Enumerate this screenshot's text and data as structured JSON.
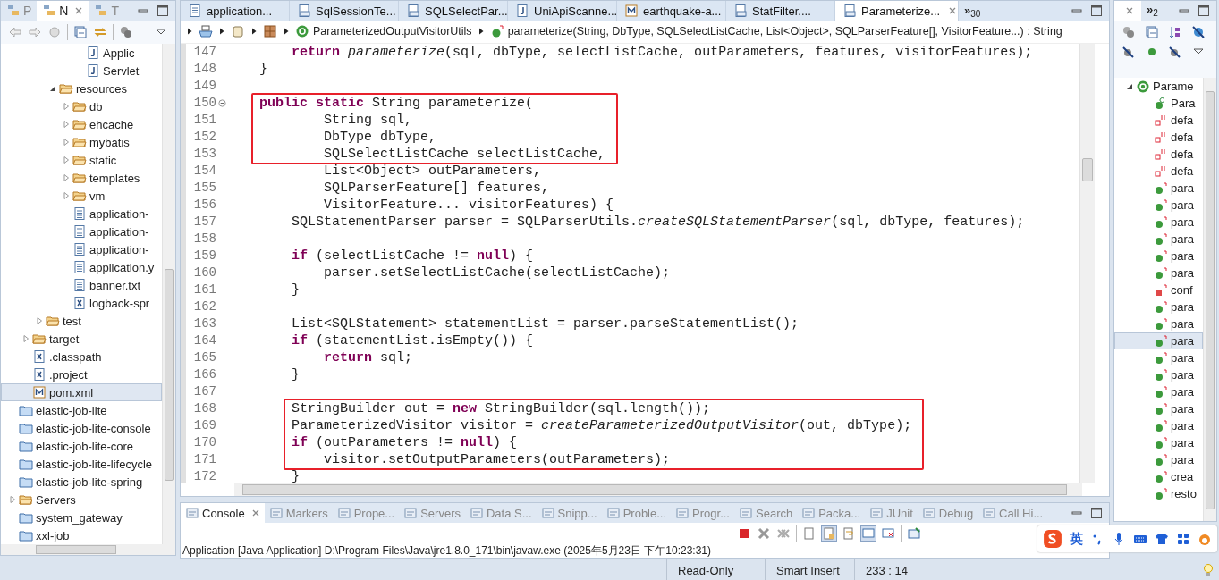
{
  "explorer": {
    "tabs": [
      {
        "label": "P",
        "selected": false
      },
      {
        "label": "N",
        "selected": true
      },
      {
        "label": "T",
        "selected": false
      }
    ],
    "tree": [
      {
        "children": [
          {
            "children": [
              {
                "children": [
                  {
                    "children": [
                      {
                        "children": [
                          {
                            "label": "Applic",
                            "kind": "java"
                          },
                          {
                            "label": "Servlet",
                            "kind": "java"
                          }
                        ]
                      }
                    ]
                  },
                  {
                    "label": "resources",
                    "kind": "folder",
                    "expanded": true,
                    "children": [
                      {
                        "label": "db",
                        "kind": "folder",
                        "expanded": false
                      },
                      {
                        "label": "ehcache",
                        "kind": "folder",
                        "expanded": false
                      },
                      {
                        "label": "mybatis",
                        "kind": "folder",
                        "expanded": false
                      },
                      {
                        "label": "static",
                        "kind": "folder",
                        "expanded": false
                      },
                      {
                        "label": "templates",
                        "kind": "folder",
                        "expanded": false
                      },
                      {
                        "label": "vm",
                        "kind": "folder",
                        "expanded": false
                      },
                      {
                        "label": "application-",
                        "kind": "file"
                      },
                      {
                        "label": "application-",
                        "kind": "file"
                      },
                      {
                        "label": "application-",
                        "kind": "file"
                      },
                      {
                        "label": "application.y",
                        "kind": "file"
                      },
                      {
                        "label": "banner.txt",
                        "kind": "file"
                      },
                      {
                        "label": "logback-spr",
                        "kind": "xml"
                      }
                    ]
                  }
                ]
              },
              {
                "label": "test",
                "kind": "folder",
                "expanded": false
              }
            ]
          },
          {
            "label": "target",
            "kind": "folder",
            "expanded": false
          },
          {
            "label": ".classpath",
            "kind": "xml"
          },
          {
            "label": ".project",
            "kind": "xml"
          },
          {
            "label": "pom.xml",
            "kind": "maven",
            "selected": true
          }
        ]
      },
      {
        "label": "elastic-job-lite",
        "kind": "project"
      },
      {
        "label": "elastic-job-lite-console",
        "kind": "project"
      },
      {
        "label": "elastic-job-lite-core",
        "kind": "project"
      },
      {
        "label": "elastic-job-lite-lifecycle",
        "kind": "project"
      },
      {
        "label": "elastic-job-lite-spring",
        "kind": "project"
      },
      {
        "label": "Servers",
        "kind": "folder",
        "expanded": false
      },
      {
        "label": "system_gateway",
        "kind": "project"
      },
      {
        "label": "xxl-job",
        "kind": "project"
      }
    ]
  },
  "editor": {
    "tabs": [
      {
        "label": "application...",
        "kind": "file",
        "selected": false
      },
      {
        "label": "SqlSessionTe...",
        "kind": "class",
        "selected": false
      },
      {
        "label": "SQLSelectPar...",
        "kind": "class",
        "selected": false
      },
      {
        "label": "UniApiScanne...",
        "kind": "java",
        "selected": false
      },
      {
        "label": "earthquake-a...",
        "kind": "maven",
        "selected": false
      },
      {
        "label": "StatFilter....",
        "kind": "class",
        "selected": false
      },
      {
        "label": "Parameterize...",
        "kind": "class",
        "selected": true
      }
    ],
    "more_tabs": {
      "glyph": "»",
      "count": "30"
    },
    "breadcrumb": [
      {
        "label": "ParameterizedOutputVisitorUtils",
        "kind": "class"
      },
      {
        "label": "parameterize(String, DbType, SQLSelectListCache, List<Object>, SQLParserFeature[], VisitorFeature...) : String",
        "kind": "method"
      }
    ],
    "blocks": [
      {
        "boxed": false,
        "lines": [
          {
            "num": "147",
            "text": "        **return** *parameterize*(sql, dbType, selectListCache, outParameters, features, visitorFeatures);"
          },
          {
            "num": "148",
            "text": "    }"
          },
          {
            "num": "149"
          }
        ]
      },
      {
        "boxed": true,
        "lines": [
          {
            "num": "150",
            "text": "    **public** **static** String parameterize(",
            "folded": false
          },
          {
            "num": "151",
            "text": "            String sql,"
          },
          {
            "num": "152",
            "text": "            DbType dbType,"
          },
          {
            "num": "153",
            "text": "            SQLSelectListCache selectListCache,"
          }
        ]
      },
      {
        "boxed": false,
        "lines": [
          {
            "num": "154",
            "text": "            List<Object> outParameters,"
          },
          {
            "num": "155",
            "text": "            SQLParserFeature[] features,"
          },
          {
            "num": "156",
            "text": "            VisitorFeature... visitorFeatures) {"
          },
          {
            "num": "157",
            "text": "        SQLStatementParser parser = SQLParserUtils.*createSQLStatementParser*(sql, dbType, features);"
          },
          {
            "num": "158"
          },
          {
            "num": "159",
            "text": "        **if** (selectListCache != **null**) {"
          },
          {
            "num": "160",
            "text": "            parser.setSelectListCache(selectListCache);"
          },
          {
            "num": "161",
            "text": "        }"
          },
          {
            "num": "162"
          },
          {
            "num": "163",
            "text": "        List<SQLStatement> statementList = parser.parseStatementList();"
          },
          {
            "num": "164",
            "text": "        **if** (statementList.isEmpty()) {"
          },
          {
            "num": "165",
            "text": "            **return** sql;"
          },
          {
            "num": "166",
            "text": "        }"
          },
          {
            "num": "167"
          }
        ]
      },
      {
        "boxed": true,
        "lines": [
          {
            "num": "168",
            "text": "        StringBuilder out = **new** StringBuilder(sql.length());"
          },
          {
            "num": "169",
            "text": "        ParameterizedVisitor visitor = *createParameterizedOutputVisitor*(out, dbType);"
          },
          {
            "num": "170",
            "text": "        **if** (outParameters != **null**) {"
          },
          {
            "num": "171",
            "text": "            visitor.setOutputParameters(outParameters);"
          }
        ]
      },
      {
        "boxed": false,
        "lines": [
          {
            "num": "172",
            "text": "        }"
          }
        ]
      }
    ]
  },
  "outline": {
    "more_tabs": {
      "glyph": "»",
      "count": "2"
    },
    "tree": [
      {
        "label": "Parame",
        "kind": "class",
        "expanded": true,
        "children": [
          {
            "label": "Para",
            "kind": "constructor",
            "selected": false
          },
          {
            "label": "defa",
            "kind": "field",
            "selected": false
          },
          {
            "label": "defa",
            "kind": "field",
            "selected": false
          },
          {
            "label": "defa",
            "kind": "field",
            "selected": false
          },
          {
            "label": "defa",
            "kind": "field",
            "selected": false
          },
          {
            "label": "para",
            "kind": "method",
            "selected": false
          },
          {
            "label": "para",
            "kind": "method",
            "selected": false
          },
          {
            "label": "para",
            "kind": "method",
            "selected": false
          },
          {
            "label": "para",
            "kind": "method",
            "selected": false
          },
          {
            "label": "para",
            "kind": "method",
            "selected": false
          },
          {
            "label": "para",
            "kind": "method",
            "selected": false
          },
          {
            "label": "conf",
            "kind": "private",
            "selected": false
          },
          {
            "label": "para",
            "kind": "method",
            "selected": false
          },
          {
            "label": "para",
            "kind": "method",
            "selected": false
          },
          {
            "label": "para",
            "kind": "method",
            "selected": true
          },
          {
            "label": "para",
            "kind": "method",
            "selected": false
          },
          {
            "label": "para",
            "kind": "method",
            "selected": false
          },
          {
            "label": "para",
            "kind": "method",
            "selected": false
          },
          {
            "label": "para",
            "kind": "method",
            "selected": false
          },
          {
            "label": "para",
            "kind": "method",
            "selected": false
          },
          {
            "label": "para",
            "kind": "method",
            "selected": false
          },
          {
            "label": "para",
            "kind": "method",
            "selected": false
          },
          {
            "label": "crea",
            "kind": "method",
            "selected": false
          },
          {
            "label": "resto",
            "kind": "method",
            "selected": false
          }
        ]
      }
    ]
  },
  "console": {
    "tabs": [
      {
        "label": "Console",
        "selected": true
      },
      {
        "label": "Markers",
        "selected": false
      },
      {
        "label": "Prope...",
        "selected": false
      },
      {
        "label": "Servers",
        "selected": false
      },
      {
        "label": "Data S...",
        "selected": false
      },
      {
        "label": "Snipp...",
        "selected": false
      },
      {
        "label": "Proble...",
        "selected": false
      },
      {
        "label": "Progr...",
        "selected": false
      },
      {
        "label": "Search",
        "selected": false
      },
      {
        "label": "Packa...",
        "selected": false
      },
      {
        "label": "JUnit",
        "selected": false
      },
      {
        "label": "Debug",
        "selected": false
      },
      {
        "label": "Call Hi...",
        "selected": false
      }
    ],
    "output": "Application [Java Application] D:\\Program Files\\Java\\jre1.8.0_171\\bin\\javaw.exe (2025年5月23日 下午10:23:31)"
  },
  "ime": {
    "label": "英"
  },
  "status_bar": {
    "mode": "Read-Only",
    "insert": "Smart Insert",
    "position": "233 : 14"
  }
}
